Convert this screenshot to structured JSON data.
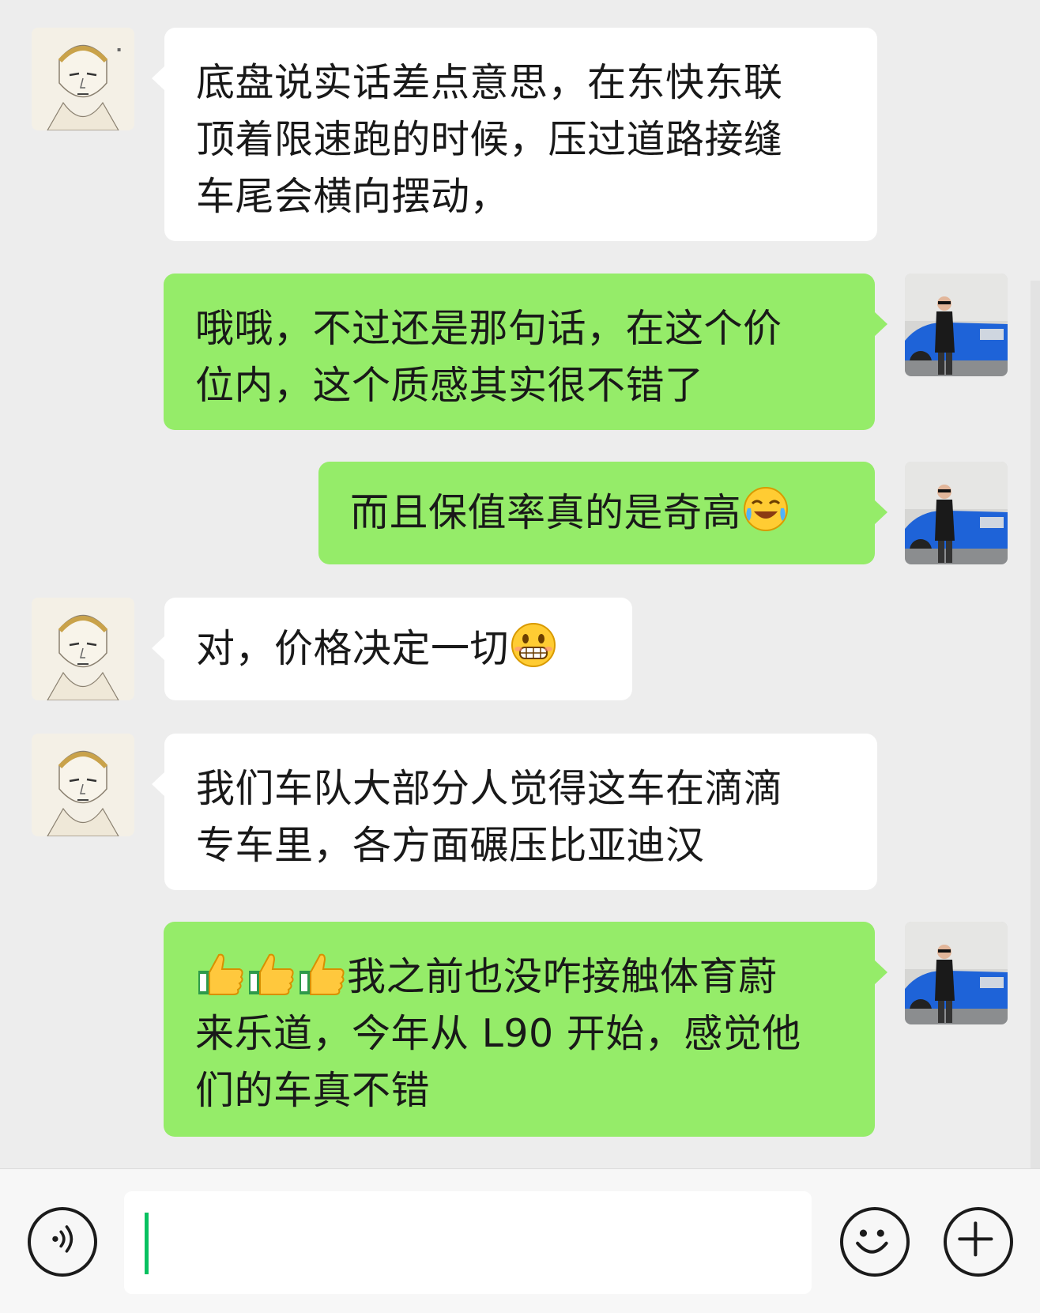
{
  "messages": [
    {
      "side": "in",
      "avatar": "anime-avatar",
      "lines": [
        "底盘说实话差点意思，在东快东联",
        "顶着限速跑的时候，压过道路接缝",
        "车尾会横向摆动，"
      ]
    },
    {
      "side": "out",
      "avatar": "photo-avatar",
      "lines": [
        "哦哦，不过还是那句话，在这个价",
        "位内，这个质感其实很不错了"
      ]
    },
    {
      "side": "out",
      "avatar": "photo-avatar",
      "text": "而且保值率真的是奇高",
      "emoji": "cry-laugh-emoji"
    },
    {
      "side": "in",
      "avatar": "anime-avatar",
      "text": "对，价格决定一切",
      "emoji": "grin-emoji"
    },
    {
      "side": "in",
      "avatar": "anime-avatar",
      "lines": [
        "我们车队大部分人觉得这车在滴滴",
        "专车里，各方面碾压比亚迪汉"
      ]
    },
    {
      "side": "out",
      "avatar": "photo-avatar",
      "emoji_prefix": [
        "thumbs-up-emoji",
        "thumbs-up-emoji",
        "thumbs-up-emoji"
      ],
      "line1_text": "我之前也没咋接触体育蔚",
      "lines_rest": [
        "来乐道，今年从 L90 开始，感觉他",
        "们的车真不错"
      ]
    }
  ],
  "input_bar": {
    "voice_icon": "voice-icon",
    "emoji_icon": "smiley-icon",
    "add_icon": "plus-icon",
    "input_value": ""
  },
  "colors": {
    "background": "#ededed",
    "outgoing_bubble": "#95ec69",
    "incoming_bubble": "#ffffff",
    "caret": "#07c160"
  }
}
